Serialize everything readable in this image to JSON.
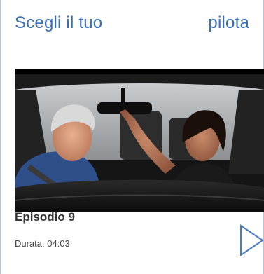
{
  "card": {
    "title_left": "Scegli il tuo",
    "title_right": "pilota"
  },
  "video": {
    "thumbnail_icon": "car-interior-photo"
  },
  "episode": {
    "title": "Episodio 9",
    "duration": "Durata: 04:03"
  },
  "controls": {
    "play_icon": "play-icon"
  },
  "colors": {
    "accent": "#3b6fb5",
    "border": "#b7c3d6",
    "play_outline": "#4a7bc4"
  }
}
